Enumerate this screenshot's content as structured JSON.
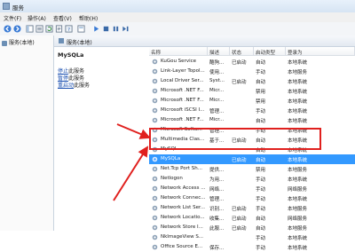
{
  "window": {
    "title": "服务"
  },
  "menu": [
    "文件(F)",
    "操作(A)",
    "查看(V)",
    "帮助(H)"
  ],
  "tree": {
    "item": "服务(本地)"
  },
  "header": {
    "title": "服务(本地)"
  },
  "desc": {
    "service_name": "MySQLa",
    "links": [
      {
        "link": "停止",
        "rest": "此服务"
      },
      {
        "link": "暂停",
        "rest": "此服务"
      },
      {
        "link": "重启动",
        "rest": "此服务"
      }
    ]
  },
  "columns": [
    "名称",
    "描述",
    "状态",
    "启动类型",
    "登录为"
  ],
  "rows": [
    {
      "name": "KuGou Service",
      "desc": "酷狗...",
      "status": "已启动",
      "startup": "自动",
      "logon": "本地系统"
    },
    {
      "name": "Link-Layer Topol...",
      "desc": "使用...",
      "status": "",
      "startup": "手动",
      "logon": "本地服务"
    },
    {
      "name": "Local Driver Ser...",
      "desc": "Syst...",
      "status": "已启动",
      "startup": "自动",
      "logon": "本地系统"
    },
    {
      "name": "Microsoft .NET F...",
      "desc": "Micr...",
      "status": "",
      "startup": "禁用",
      "logon": "本地系统"
    },
    {
      "name": "Microsoft .NET F...",
      "desc": "Micr...",
      "status": "",
      "startup": "禁用",
      "logon": "本地系统"
    },
    {
      "name": "Microsoft iSCSI I...",
      "desc": "管理...",
      "status": "",
      "startup": "手动",
      "logon": "本地系统"
    },
    {
      "name": "Microsoft .NET F...",
      "desc": "Micr...",
      "status": "",
      "startup": "自动",
      "logon": "本地系统"
    },
    {
      "name": "Microsoft Softw...",
      "desc": "管理...",
      "status": "",
      "startup": "手动",
      "logon": "本地系统"
    },
    {
      "name": "Multimedia Clas...",
      "desc": "基于...",
      "status": "已启动",
      "startup": "自动",
      "logon": "本地系统"
    },
    {
      "name": "MySQL",
      "desc": "",
      "status": "",
      "startup": "自动",
      "logon": "本地系统"
    },
    {
      "name": "MySQLa",
      "desc": "",
      "status": "已启动",
      "startup": "自动",
      "logon": "本地系统"
    },
    {
      "name": "Net.Tcp Port Sh...",
      "desc": "提供...",
      "status": "",
      "startup": "禁用",
      "logon": "本地服务"
    },
    {
      "name": "Netlogon",
      "desc": "为用...",
      "status": "",
      "startup": "手动",
      "logon": "本地系统"
    },
    {
      "name": "Network Access ...",
      "desc": "网络...",
      "status": "",
      "startup": "手动",
      "logon": "网络服务"
    },
    {
      "name": "Network Connec...",
      "desc": "管理...",
      "status": "",
      "startup": "手动",
      "logon": "本地系统"
    },
    {
      "name": "Network List Ser...",
      "desc": "识别...",
      "status": "已启动",
      "startup": "手动",
      "logon": "本地服务"
    },
    {
      "name": "Network Locatio...",
      "desc": "收集...",
      "status": "已启动",
      "startup": "自动",
      "logon": "网络服务"
    },
    {
      "name": "Network Store I...",
      "desc": "此服...",
      "status": "已启动",
      "startup": "自动",
      "logon": "本地服务"
    },
    {
      "name": "NkImageView S...",
      "desc": "",
      "status": "",
      "startup": "手动",
      "logon": "本地系统"
    },
    {
      "name": "Office Source E...",
      "desc": "保存...",
      "status": "",
      "startup": "手动",
      "logon": "本地系统"
    }
  ],
  "selected_index": 10,
  "colors": {
    "accent": "#3399ff",
    "highlight": "#e0201e"
  }
}
